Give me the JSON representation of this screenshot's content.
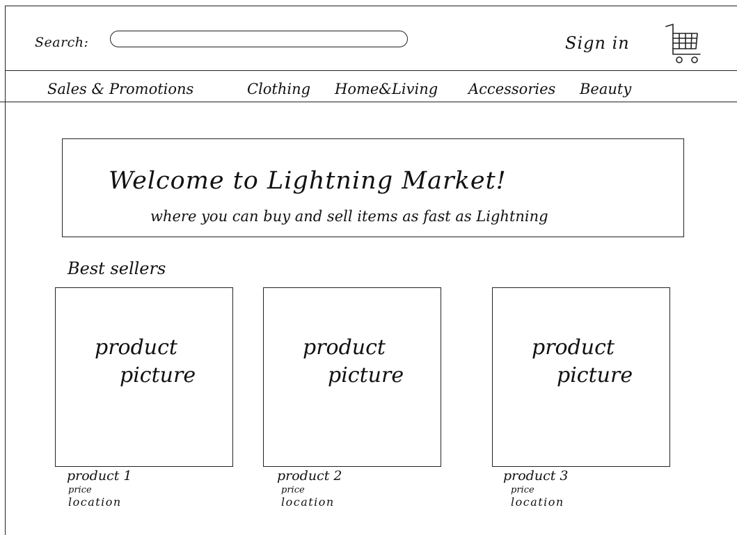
{
  "header": {
    "search_label": "Search:",
    "search_value": "",
    "sign_in_label": "Sign in",
    "cart_icon": "shopping-cart-icon"
  },
  "nav": {
    "items": [
      {
        "label": "Sales & Promotions"
      },
      {
        "label": "Clothing"
      },
      {
        "label": "Home&Living"
      },
      {
        "label": "Accessories"
      },
      {
        "label": "Beauty"
      }
    ]
  },
  "banner": {
    "title": "Welcome to Lightning Market!",
    "subtitle": "where you can buy and sell items as fast as Lightning"
  },
  "best_sellers": {
    "heading": "Best sellers",
    "products": [
      {
        "picture_line1": "product",
        "picture_line2": "picture",
        "name": "product 1",
        "price": "price",
        "location": "location"
      },
      {
        "picture_line1": "product",
        "picture_line2": "picture",
        "name": "product 2",
        "price": "price",
        "location": "location"
      },
      {
        "picture_line1": "product",
        "picture_line2": "picture",
        "name": "product 3",
        "price": "price",
        "location": "location"
      }
    ]
  },
  "colors": {
    "ink": "#222222",
    "background": "#ffffff"
  }
}
